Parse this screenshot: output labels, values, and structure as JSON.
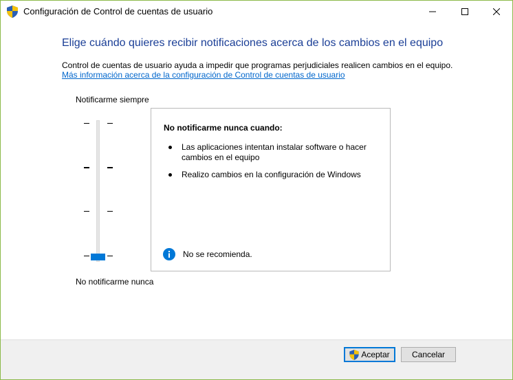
{
  "window": {
    "title": "Configuración de Control de cuentas de usuario",
    "title_icon": "uac-shield-icon",
    "controls": {
      "minimize": "minimize-icon",
      "maximize": "maximize-icon",
      "close": "close-icon"
    }
  },
  "main": {
    "heading": "Elige cuándo quieres recibir notificaciones acerca de los cambios en el equipo",
    "description": "Control de cuentas de usuario ayuda a impedir que programas perjudiciales realicen cambios en el equipo.",
    "link": "Más información acerca de la configuración de Control de cuentas de usuario"
  },
  "slider": {
    "top_label": "Notificarme siempre",
    "bottom_label": "No notificarme nunca",
    "levels": 4,
    "selected_level": 1,
    "selected_level_note": "1 = bottom (No notificarme nunca), 4 = top"
  },
  "info": {
    "title": "No notificarme nunca cuando:",
    "bullets": [
      "Las aplicaciones intentan instalar software o hacer cambios en el equipo",
      "Realizo cambios en la configuración de Windows"
    ],
    "note_icon": "info-icon",
    "note": "No se recomienda."
  },
  "footer": {
    "ok_label": "Aceptar",
    "cancel_label": "Cancelar"
  },
  "colors": {
    "heading": "#1a3e96",
    "link": "#0066cc",
    "accent": "#0078d7",
    "window_border": "#8cb94a"
  }
}
